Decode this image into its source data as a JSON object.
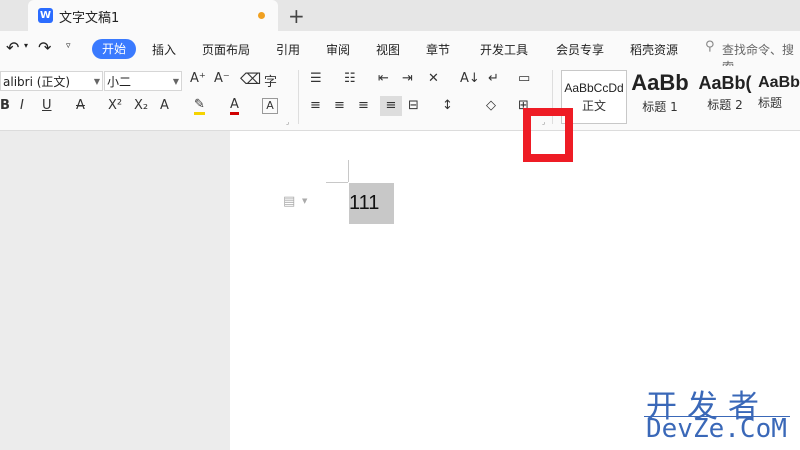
{
  "tab": {
    "title": "文字文稿1",
    "icon_letter": "W"
  },
  "menu": {
    "items": [
      "开始",
      "插入",
      "页面布局",
      "引用",
      "审阅",
      "视图",
      "章节",
      "开发工具",
      "会员专享",
      "稻壳资源"
    ],
    "search_placeholder": "查找命令、搜索"
  },
  "ribbon": {
    "font_name": "alibri (正文)",
    "font_size": "小二",
    "styles": [
      {
        "sample": "AaBbCcDd",
        "label": "正文"
      },
      {
        "sample": "AaBb",
        "label": "标题 1"
      },
      {
        "sample": "AaBb(",
        "label": "标题 2"
      },
      {
        "sample": "AaBb",
        "label": "标题"
      }
    ]
  },
  "document": {
    "text": "111"
  },
  "watermark": {
    "line1": "开发者",
    "line2": "DevZe.CoM"
  },
  "colors": {
    "accent": "#3a7afe",
    "highlight_box": "#ee1c25",
    "watermark": "#3a68b8"
  }
}
